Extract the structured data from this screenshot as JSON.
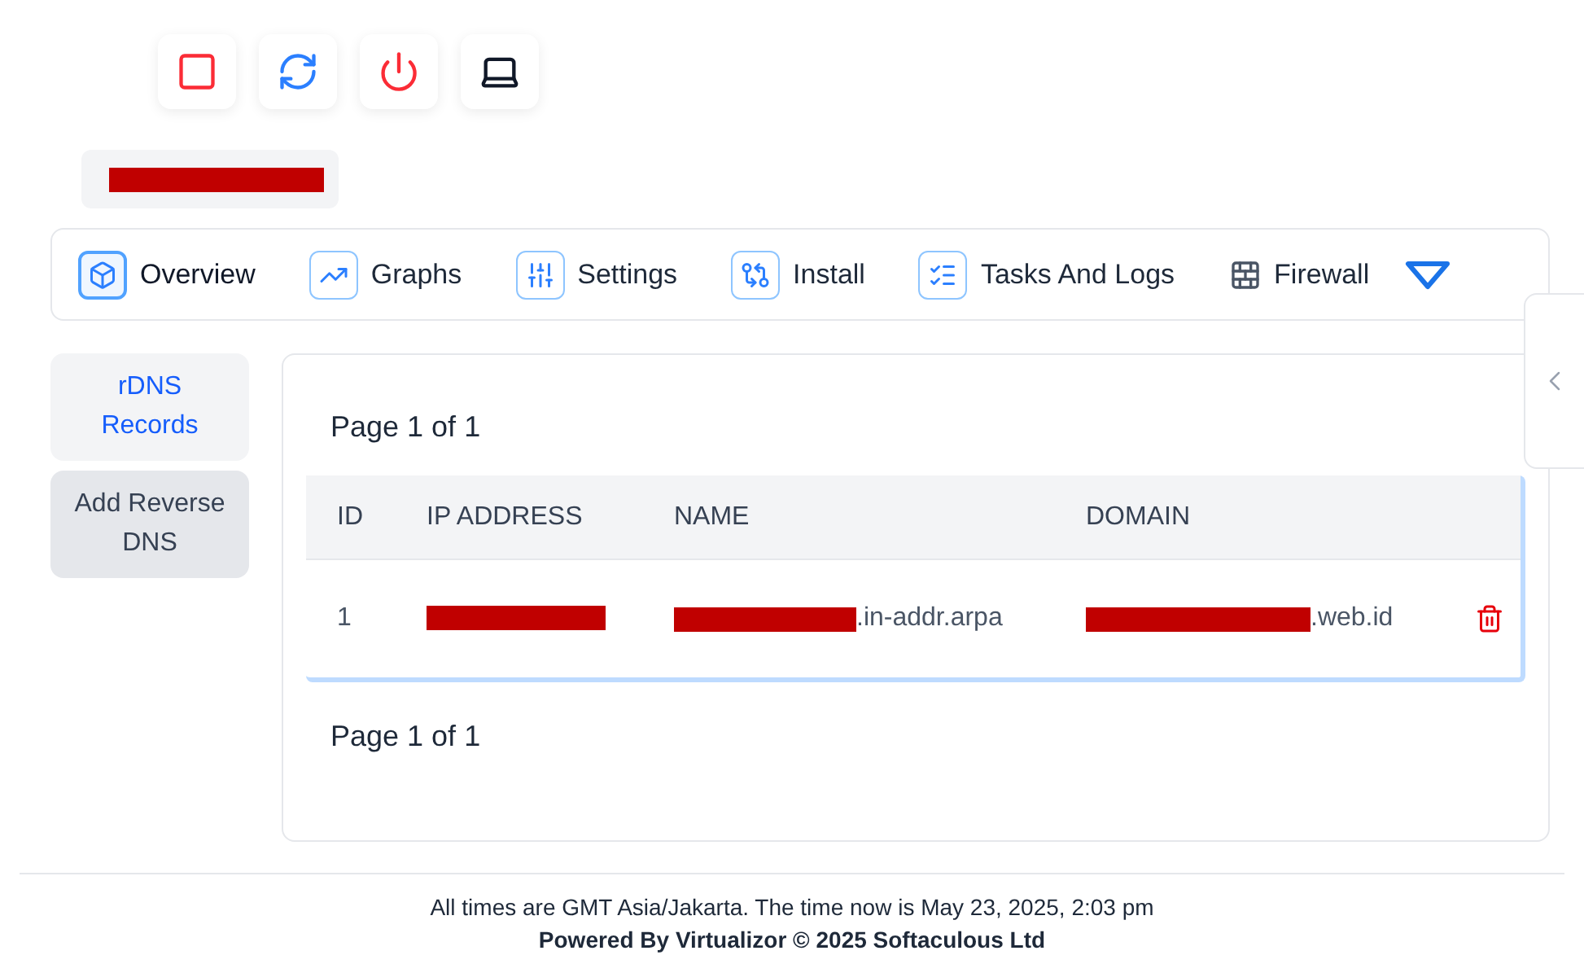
{
  "tabs": [
    {
      "label": "Overview",
      "selected": true
    },
    {
      "label": "Graphs",
      "selected": false
    },
    {
      "label": "Settings",
      "selected": false
    },
    {
      "label": "Install",
      "selected": false
    },
    {
      "label": "Tasks And Logs",
      "selected": false
    },
    {
      "label": "Firewall",
      "selected": false
    }
  ],
  "side_menu": [
    {
      "label": "rDNS Records",
      "selected": true
    },
    {
      "label": "Add Reverse DNS",
      "selected": false
    }
  ],
  "pagination_top": "Page 1 of 1",
  "table": {
    "columns": [
      "ID",
      "IP ADDRESS",
      "NAME",
      "DOMAIN"
    ],
    "rows": [
      {
        "id": "1",
        "name_suffix": ".in-addr.arpa",
        "domain_suffix": ".web.id"
      }
    ]
  },
  "pagination_bottom": "Page 1 of 1",
  "footer": {
    "timezone_note": "All times are GMT Asia/Jakarta. The time now is May 23, 2025, 2:03 pm",
    "powered_by": "Powered By Virtualizor © 2025 Softaculous Ltd"
  }
}
